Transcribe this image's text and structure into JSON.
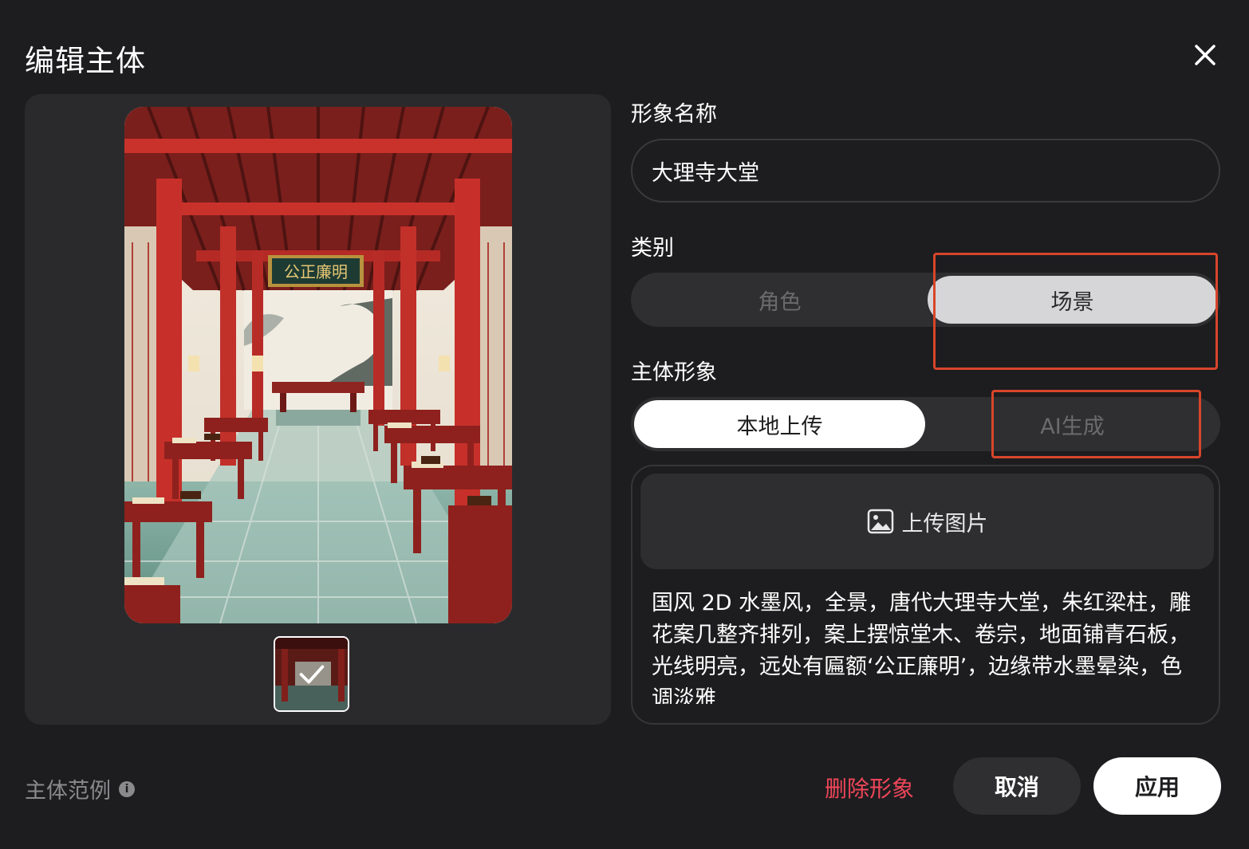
{
  "dialog": {
    "title": "编辑主体",
    "close_icon": "close-icon"
  },
  "form": {
    "name_label": "形象名称",
    "name_value": "大理寺大堂",
    "category_label": "类别",
    "category_options": [
      "角色",
      "场景"
    ],
    "category_selected": "场景",
    "image_label": "主体形象",
    "image_source_options": [
      "本地上传",
      "AI生成"
    ],
    "image_source_selected": "本地上传",
    "upload_button": "上传图片",
    "upload_icon": "image-icon",
    "prompt": "国风 2D 水墨风，全景，唐代大理寺大堂，朱红梁柱，雕花案几整齐排列，案上摆惊堂木、卷宗，地面铺青石板，光线明亮，远处有匾额‘公正廉明’，边缘带水墨晕染，色调淡雅"
  },
  "preview": {
    "plaque_text": "公正廉明",
    "thumbnail_selected_icon": "check-icon"
  },
  "footer": {
    "example_label": "主体范例",
    "info_icon": "info-icon",
    "delete_label": "删除形象",
    "cancel_label": "取消",
    "apply_label": "应用"
  },
  "colors": {
    "background": "#1d1d1f",
    "panel": "#2a2a2c",
    "danger": "#f0455a",
    "highlight_box": "#d8452b"
  }
}
